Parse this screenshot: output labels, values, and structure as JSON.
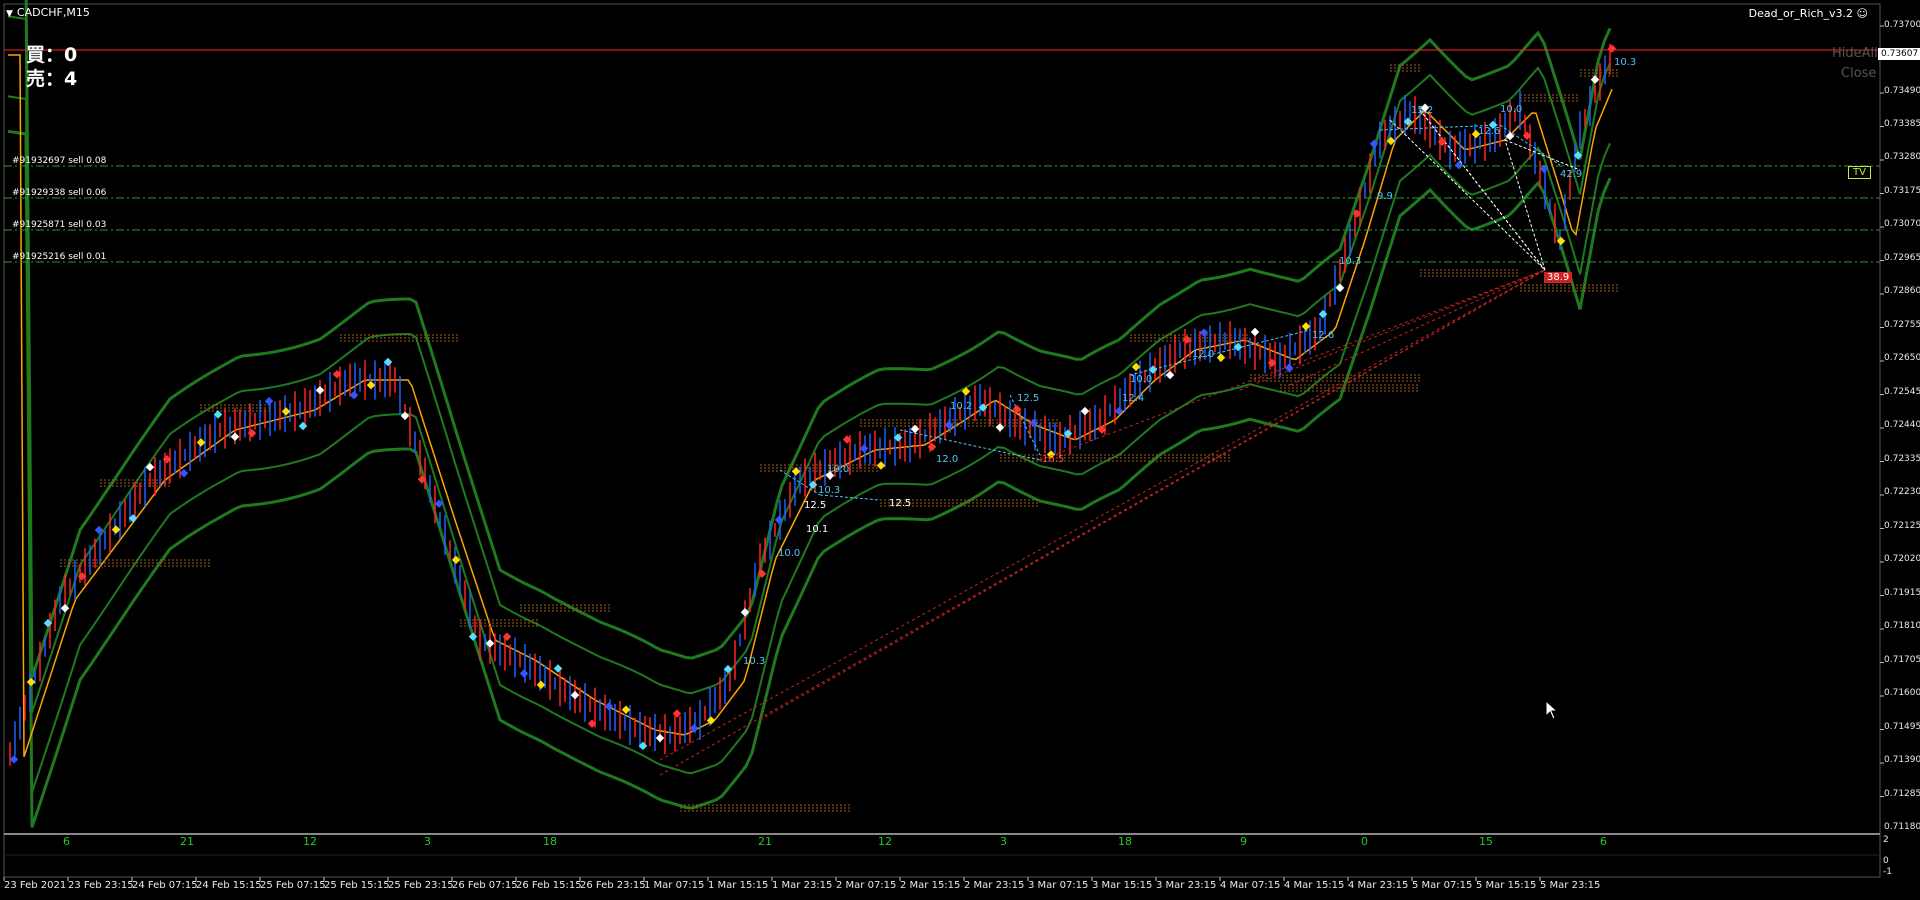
{
  "window": {
    "symbol": "CADCHF,M15",
    "indicator": "Dead_or_Rich_v3.2"
  },
  "positions": {
    "buy_label": "買：0",
    "sell_label": "売：4"
  },
  "buttons": {
    "hide_all": "HideAll",
    "close": "Close",
    "tv": "TV"
  },
  "orders": [
    {
      "label": "#91932697 sell 0.08"
    },
    {
      "label": "#91929338 sell 0.06"
    },
    {
      "label": "#91925871 sell 0.03"
    },
    {
      "label": "#91925216 sell 0.01"
    }
  ],
  "price_axis": {
    "current_price": "0.73607",
    "ticks": [
      "0.73700",
      "0.73490",
      "0.73385",
      "0.73280",
      "0.73175",
      "0.73070",
      "0.72965",
      "0.72860",
      "0.72755",
      "0.72650",
      "0.72545",
      "0.72440",
      "0.72335",
      "0.72230",
      "0.72125",
      "0.72020",
      "0.71915",
      "0.71810",
      "0.71705",
      "0.71600",
      "0.71495",
      "0.71390",
      "0.71285",
      "0.71180"
    ]
  },
  "time_axis": {
    "ticks": [
      "23 Feb 2021",
      "23 Feb 23:15",
      "24 Feb 07:15",
      "24 Feb 15:15",
      "25 Feb 07:15",
      "25 Feb 15:15",
      "25 Feb 23:15",
      "26 Feb 07:15",
      "26 Feb 15:15",
      "26 Feb 23:15",
      "1 Mar 07:15",
      "1 Mar 15:15",
      "1 Mar 23:15",
      "2 Mar 07:15",
      "2 Mar 15:15",
      "2 Mar 23:15",
      "3 Mar 07:15",
      "3 Mar 15:15",
      "3 Mar 23:15",
      "4 Mar 07:15",
      "4 Mar 15:15",
      "4 Mar 23:15",
      "5 Mar 07:15",
      "5 Mar 15:15",
      "5 Mar 23:15"
    ]
  },
  "subwindow": {
    "labels": [
      "6",
      "21",
      "12",
      "3",
      "18",
      "21",
      "12",
      "3",
      "18",
      "9",
      "0",
      "15",
      "6"
    ],
    "scale": [
      "2",
      "0",
      "-1"
    ]
  },
  "annotations": [
    {
      "text": "10.3",
      "color": "#4fc3f7"
    },
    {
      "text": "15.2",
      "color": "#4fc3f7"
    },
    {
      "text": "12.6",
      "color": "#4fc3f7"
    },
    {
      "text": "10.0",
      "color": "#4fc3f7"
    },
    {
      "text": "42.9",
      "color": "#4fc3f7"
    },
    {
      "text": "9.9",
      "color": "#4fc3f7"
    },
    {
      "text": "10.3",
      "color": "#4fc3f7"
    },
    {
      "text": "38.9",
      "color": "#ff4444"
    },
    {
      "text": "12.6",
      "color": "#4fc3f7"
    },
    {
      "text": "12.0",
      "color": "#4fc3f7"
    },
    {
      "text": "10.0",
      "color": "#4fc3f7"
    },
    {
      "text": "12.4",
      "color": "#4fc3f7"
    },
    {
      "text": "12.5",
      "color": "#4fc3f7"
    },
    {
      "text": "10.2",
      "color": "#4fc3f7"
    },
    {
      "text": "16.5",
      "color": "#ff4444"
    },
    {
      "text": "12.0",
      "color": "#4fc3f7"
    },
    {
      "text": "10.0",
      "color": "#4fc3f7"
    },
    {
      "text": "10.3",
      "color": "#4fc3f7"
    },
    {
      "text": "12.5",
      "color": "#ffffff"
    },
    {
      "text": "12.5",
      "color": "#ffffff"
    },
    {
      "text": "10.1",
      "color": "#ffffff"
    },
    {
      "text": "10.0",
      "color": "#4fc3f7"
    },
    {
      "text": "10.3",
      "color": "#4fc3f7"
    }
  ],
  "colors": {
    "background": "#000000",
    "candle_up": "#1e5fff",
    "candle_down": "#ff2222",
    "ma_line": "#ffa500",
    "bands": "#1f7a1f",
    "order_line": "#2a9d2a",
    "price_line": "#ff2222",
    "trend_lines": "#cc2222"
  }
}
